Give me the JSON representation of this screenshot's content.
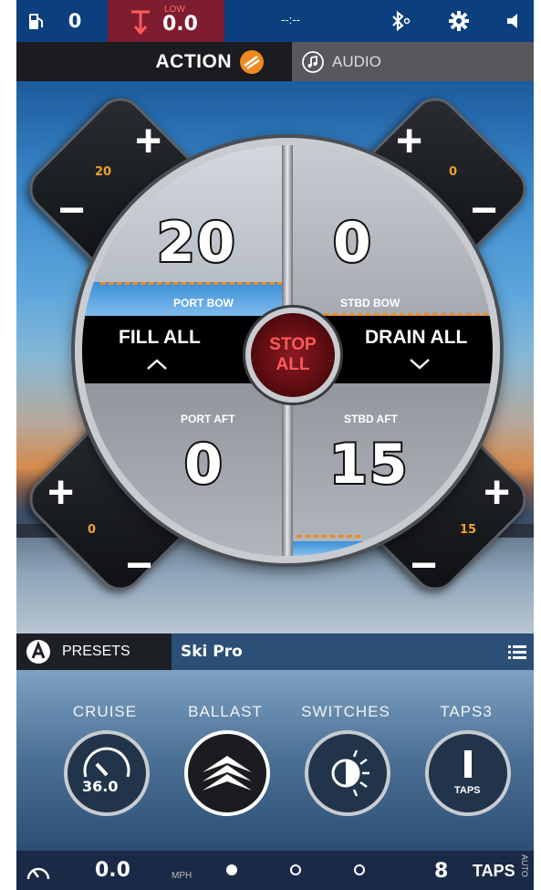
{
  "status_bar": {
    "fuel_value": "0",
    "depth_alert": "LOW",
    "depth_value": "0.0",
    "clock": "--:--",
    "icons": [
      "fuel-icon",
      "anchor-icon",
      "bluetooth-icon",
      "gear-icon",
      "speaker-icon"
    ]
  },
  "tabs": {
    "action_label": "ACTION",
    "audio_label": "AUDIO"
  },
  "ballast": {
    "port_bow": {
      "label": "PORT BOW",
      "value": "20",
      "level": "20"
    },
    "stbd_bow": {
      "label": "STBD BOW",
      "value": "0",
      "level": "0"
    },
    "port_aft": {
      "label": "PORT AFT",
      "value": "0",
      "level": "0"
    },
    "stbd_aft": {
      "label": "STBD AFT",
      "value": "15",
      "level": "15"
    },
    "fill_all_label": "FILL ALL",
    "drain_all_label": "DRAIN ALL",
    "stop_label_1": "STOP",
    "stop_label_2": "ALL",
    "plus": "+",
    "minus": "−"
  },
  "presets": {
    "label": "PRESETS",
    "selected": "Ski Pro"
  },
  "modes": [
    {
      "label": "CRUISE",
      "value": "36.0"
    },
    {
      "label": "BALLAST"
    },
    {
      "label": "SWITCHES"
    },
    {
      "label": "TAPS3",
      "sub": "TAPS"
    }
  ],
  "bottom_bar": {
    "speed": "0.0",
    "speed_unit": "MPH",
    "page_count": 3,
    "active_page": 1,
    "taps_value": "8",
    "taps_label": "TAPS",
    "auto_label": "AUTO"
  },
  "colors": {
    "status_bg": "#0b3f7e",
    "accent_orange": "#f08a20",
    "stop_red": "#8b1a22",
    "water_blue": "#3a8fd8"
  }
}
